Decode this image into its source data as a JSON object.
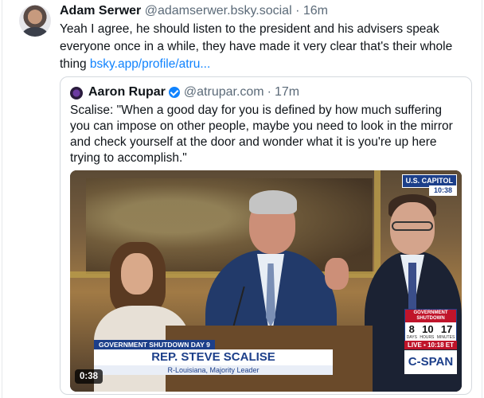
{
  "post": {
    "author_name": "Adam Serwer",
    "author_handle": "@adamserwer.bsky.social",
    "separator": "·",
    "time": "16m",
    "text": "Yeah I agree, he should listen to the president and his advisers speak everyone once in a while, they have made it very clear that's their whole thing ",
    "link_text": "bsky.app/profile/atru..."
  },
  "quote": {
    "author_name": "Aaron Rupar",
    "author_handle": "@atrupar.com",
    "separator": "·",
    "time": "17m",
    "text": "Scalise: \"When a good day for you is defined by how much suffering you can impose on other people, maybe you need to look in the mirror and check yourself at the door and wonder what it is you're up here trying to accomplish.\""
  },
  "video": {
    "duration": "0:38",
    "location_badge": "U.S. CAPITOL",
    "location_time": "10:38",
    "clock_title": "GOVERNMENT SHUTDOWN",
    "clock_days": "8",
    "clock_hours": "10",
    "clock_minutes": "17",
    "clock_unit_days": "DAYS",
    "clock_unit_hours": "HOURS",
    "clock_unit_minutes": "MINUTES",
    "tag": "GOVERNMENT SHUTDOWN DAY 9",
    "name": "REP. STEVE SCALISE",
    "subtitle": "R-Louisiana, Majority Leader",
    "live": "LIVE ▪ 10:18 ET",
    "network": "C-SPAN"
  },
  "colors": {
    "link": "#1083fe",
    "muted": "#5b6a78",
    "verified": "#1083fe",
    "cspan_blue": "#1c3f8a",
    "live_red": "#c0142a"
  },
  "icons": {
    "verified": "verified-badge-icon"
  }
}
